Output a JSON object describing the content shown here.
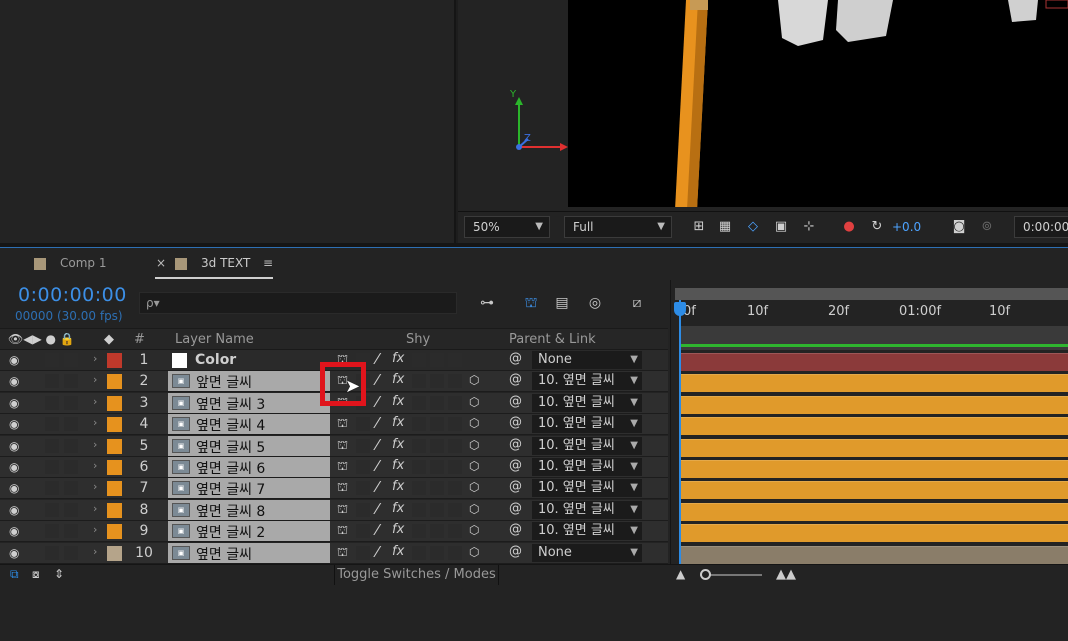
{
  "viewer": {
    "zoom": "50%",
    "resolution": "Full",
    "exposure": "+0.0",
    "time": "0:00:00",
    "axes": {
      "y": "Y",
      "z": "Z",
      "x": "X"
    }
  },
  "tabs": [
    {
      "label": "Comp 1",
      "color": "#a89779"
    },
    {
      "label": "3d TEXT",
      "color": "#a89779",
      "active": true
    }
  ],
  "timecode": "0:00:00:00",
  "fps": "00000 (30.00 fps)",
  "search": {
    "placeholder": "ρ▾"
  },
  "columns": {
    "num": "#",
    "layer_name": "Layer Name",
    "shy": "Shy",
    "parent": "Parent & Link"
  },
  "layers": [
    {
      "num": "1",
      "name": "Color",
      "label_color": "#c0392b",
      "parent": "None",
      "type": "solid"
    },
    {
      "num": "2",
      "name": "앞면 글씨",
      "label_color": "#e6921e",
      "parent": "10. 옆면 글씨"
    },
    {
      "num": "3",
      "name": "옆면 글씨 3",
      "label_color": "#e6921e",
      "parent": "10. 옆면 글씨"
    },
    {
      "num": "4",
      "name": "옆면 글씨 4",
      "label_color": "#e6921e",
      "parent": "10. 옆면 글씨"
    },
    {
      "num": "5",
      "name": "옆면 글씨 5",
      "label_color": "#e6921e",
      "parent": "10. 옆면 글씨"
    },
    {
      "num": "6",
      "name": "옆면 글씨 6",
      "label_color": "#e6921e",
      "parent": "10. 옆면 글씨"
    },
    {
      "num": "7",
      "name": "옆면 글씨 7",
      "label_color": "#e6921e",
      "parent": "10. 옆면 글씨"
    },
    {
      "num": "8",
      "name": "옆면 글씨 8",
      "label_color": "#e6921e",
      "parent": "10. 옆면 글씨"
    },
    {
      "num": "9",
      "name": "옆면 글씨 2",
      "label_color": "#e6921e",
      "parent": "10. 옆면 글씨"
    },
    {
      "num": "10",
      "name": "옆면 글씨",
      "label_color": "#b5a48a",
      "parent": "None"
    }
  ],
  "ruler": [
    "0f",
    "10f",
    "20f",
    "01:00f",
    "10f"
  ],
  "bars": [
    {
      "color": "#8b3a3a"
    },
    {
      "color": "#e09a2b"
    },
    {
      "color": "#e09a2b"
    },
    {
      "color": "#e09a2b"
    },
    {
      "color": "#e09a2b"
    },
    {
      "color": "#e09a2b"
    },
    {
      "color": "#e09a2b"
    },
    {
      "color": "#e09a2b"
    },
    {
      "color": "#e09a2b"
    },
    {
      "color": "#8a7d69"
    }
  ],
  "bottom": {
    "toggle_label": "Toggle Switches / Modes"
  }
}
